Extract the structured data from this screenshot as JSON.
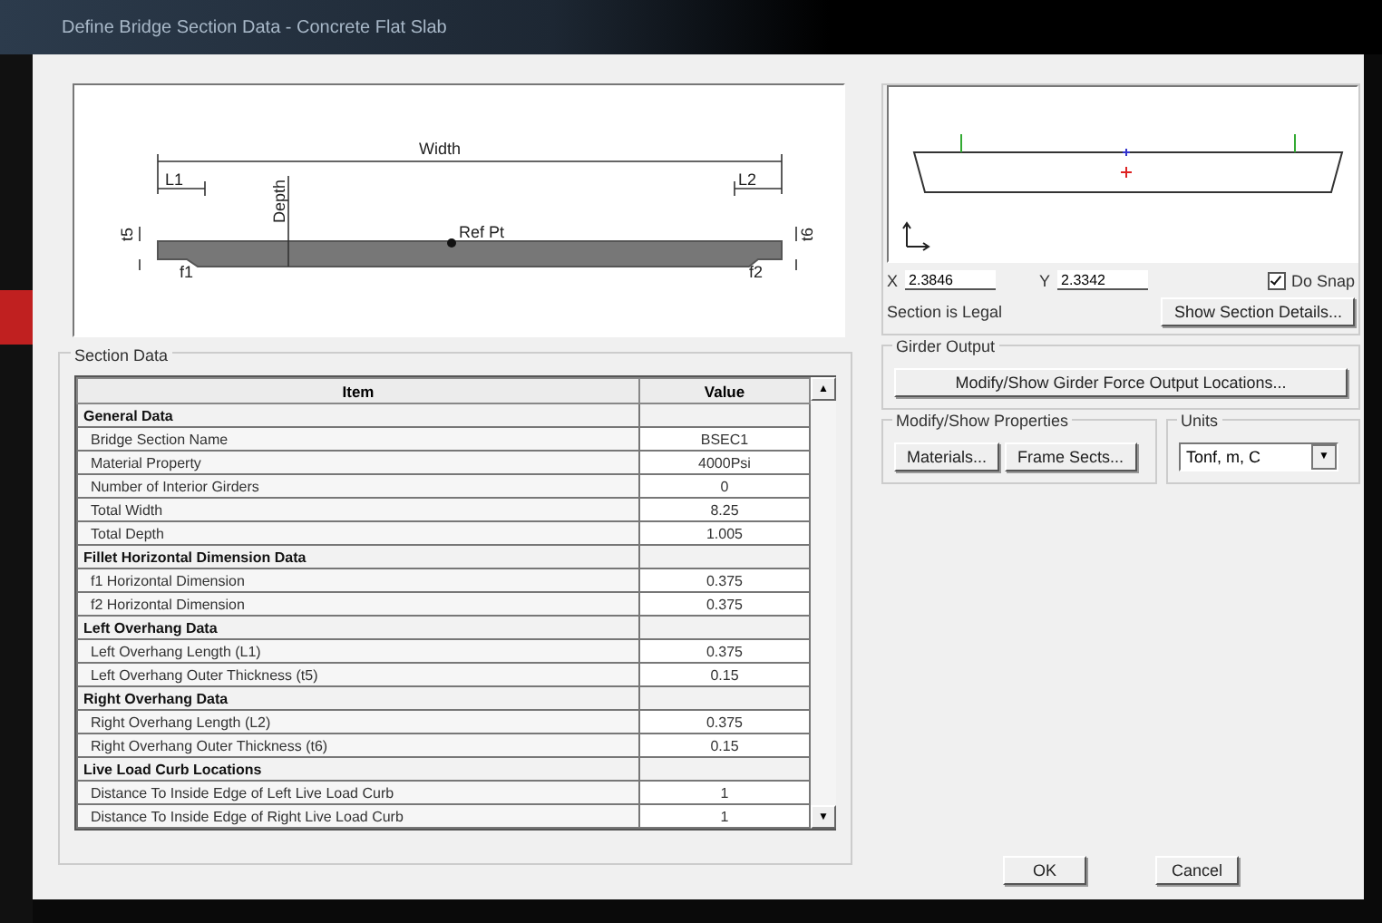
{
  "window": {
    "title": "Define Bridge Section Data - Concrete Flat Slab"
  },
  "sketch": {
    "labels": {
      "width": "Width",
      "l1": "L1",
      "l2": "L2",
      "t5": "t5",
      "depth": "Depth",
      "ref": "Ref Pt",
      "t6": "t6",
      "f1": "f1",
      "f2": "f2"
    }
  },
  "preview": {
    "x_label": "X",
    "x_value": "2.3846",
    "y_label": "Y",
    "y_value": "2.3342",
    "snap": {
      "label": "Do Snap",
      "checked": true
    },
    "status": "Section is Legal",
    "details_button": "Show Section Details..."
  },
  "section_data": {
    "title": "Section Data",
    "columns": [
      "Item",
      "Value"
    ],
    "rows": [
      {
        "kind": "header",
        "item": "General Data"
      },
      {
        "kind": "item",
        "item": "Bridge Section Name",
        "value": "BSEC1"
      },
      {
        "kind": "item",
        "item": "Material Property",
        "value": "4000Psi"
      },
      {
        "kind": "item",
        "item": "Number of Interior Girders",
        "value": "0"
      },
      {
        "kind": "item",
        "item": "Total Width",
        "value": "8.25"
      },
      {
        "kind": "item",
        "item": "Total Depth",
        "value": "1.005"
      },
      {
        "kind": "header",
        "item": "Fillet Horizontal Dimension Data"
      },
      {
        "kind": "item",
        "item": "f1 Horizontal Dimension",
        "value": "0.375"
      },
      {
        "kind": "item",
        "item": "f2 Horizontal Dimension",
        "value": "0.375"
      },
      {
        "kind": "header",
        "item": "Left Overhang Data"
      },
      {
        "kind": "item",
        "item": "Left Overhang Length (L1)",
        "value": "0.375"
      },
      {
        "kind": "item",
        "item": "Left Overhang Outer Thickness (t5)",
        "value": "0.15"
      },
      {
        "kind": "header",
        "item": "Right Overhang Data"
      },
      {
        "kind": "item",
        "item": "Right Overhang Length (L2)",
        "value": "0.375"
      },
      {
        "kind": "item",
        "item": "Right Overhang Outer Thickness (t6)",
        "value": "0.15"
      },
      {
        "kind": "header",
        "item": "Live Load Curb Locations"
      },
      {
        "kind": "item",
        "item": "Distance To Inside Edge of Left Live Load Curb",
        "value": "1"
      },
      {
        "kind": "item",
        "item": "Distance To Inside Edge of Right Live Load Curb",
        "value": "1"
      }
    ],
    "scroll_up": "▲",
    "scroll_down": "▼"
  },
  "girder_output": {
    "title": "Girder Output",
    "button": "Modify/Show Girder Force Output Locations..."
  },
  "properties": {
    "title": "Modify/Show Properties",
    "buttons": [
      "Materials...",
      "Frame Sects..."
    ]
  },
  "units": {
    "title": "Units",
    "value": "Tonf, m, C",
    "arrow": "▼"
  },
  "buttons": [
    "OK",
    "Cancel"
  ]
}
